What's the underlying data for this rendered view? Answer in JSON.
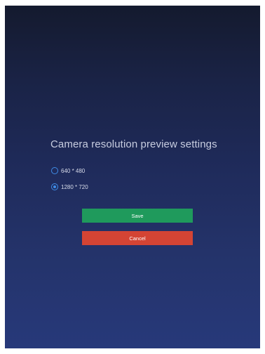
{
  "dialog": {
    "title": "Camera resolution preview settings",
    "options": [
      {
        "label": "640 * 480",
        "selected": false
      },
      {
        "label": "1280 * 720",
        "selected": true
      }
    ],
    "save_label": "Save",
    "cancel_label": "Cancel"
  },
  "colors": {
    "save": "#1f9a5c",
    "cancel": "#d44434",
    "radio_accent": "#3f8de8"
  }
}
